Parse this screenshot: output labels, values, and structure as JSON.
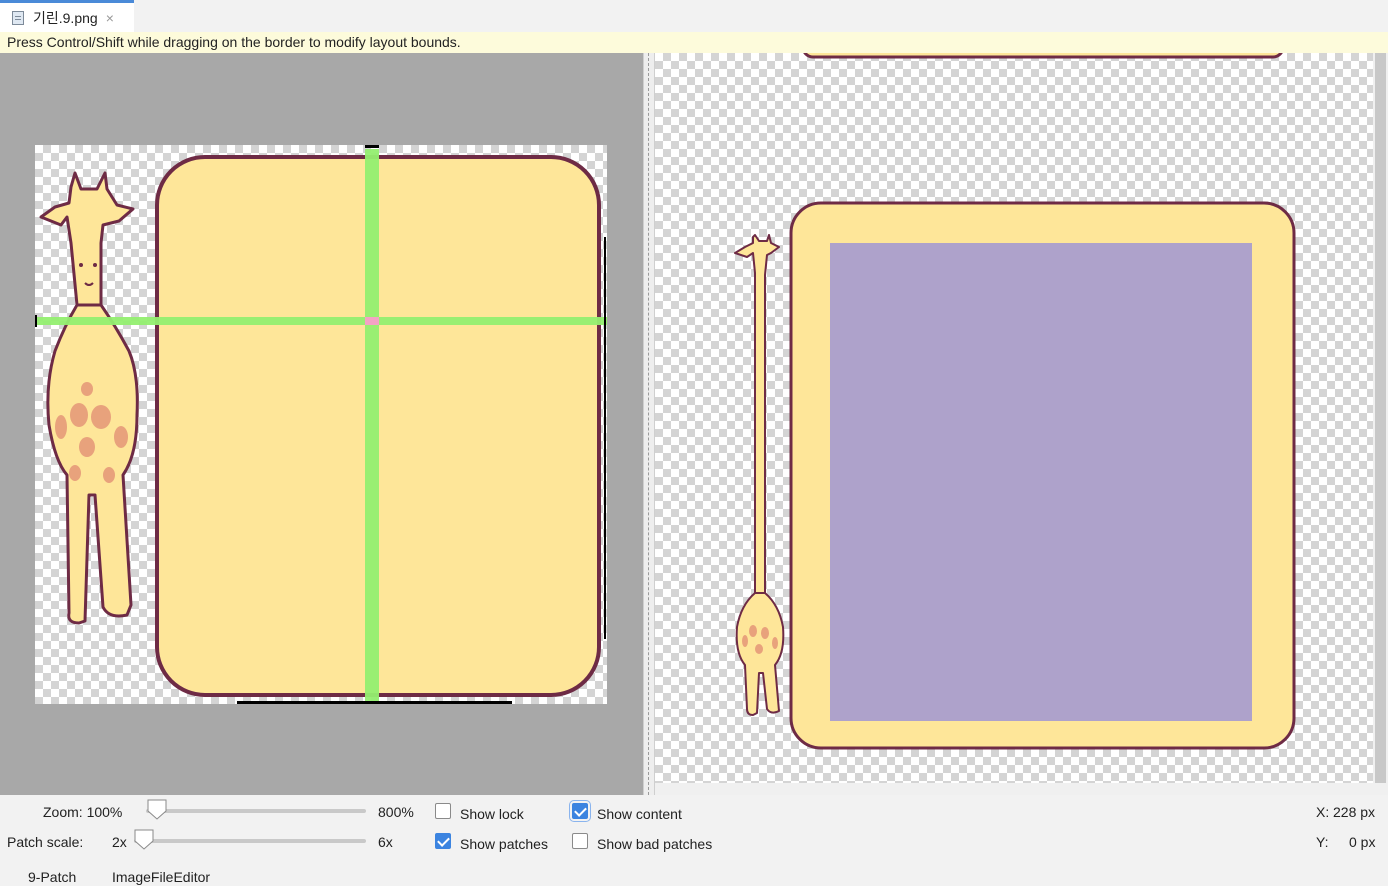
{
  "tab": {
    "title": "기린.9.png",
    "close": "×"
  },
  "notice": "Press Control/Shift while dragging on the border to modify layout bounds.",
  "zoom": {
    "label": "Zoom: 100%",
    "max_label": "800%",
    "value_fraction": 0.0
  },
  "patch_scale": {
    "label": "Patch scale:",
    "min_label": "2x",
    "max_label": "6x",
    "value_fraction": 0.0
  },
  "checkboxes": {
    "show_lock": {
      "label": "Show lock",
      "checked": false
    },
    "show_content": {
      "label": "Show content",
      "checked": true
    },
    "show_patches": {
      "label": "Show patches",
      "checked": true
    },
    "show_bad_patches": {
      "label": "Show bad patches",
      "checked": false
    }
  },
  "coords": {
    "x_label": "X:",
    "x_value": "228 px",
    "y_label": "Y:",
    "y_value": "0 px"
  },
  "bottom_tabs": [
    "9-Patch",
    "ImageFileEditor"
  ],
  "colors": {
    "box_fill": "#fee699",
    "box_border": "#6e2b45",
    "patch_green": "#93ef70",
    "patch_overlap": "#f4a3c4",
    "content_purple": "#aea2cb",
    "accent": "#3c84e0"
  }
}
